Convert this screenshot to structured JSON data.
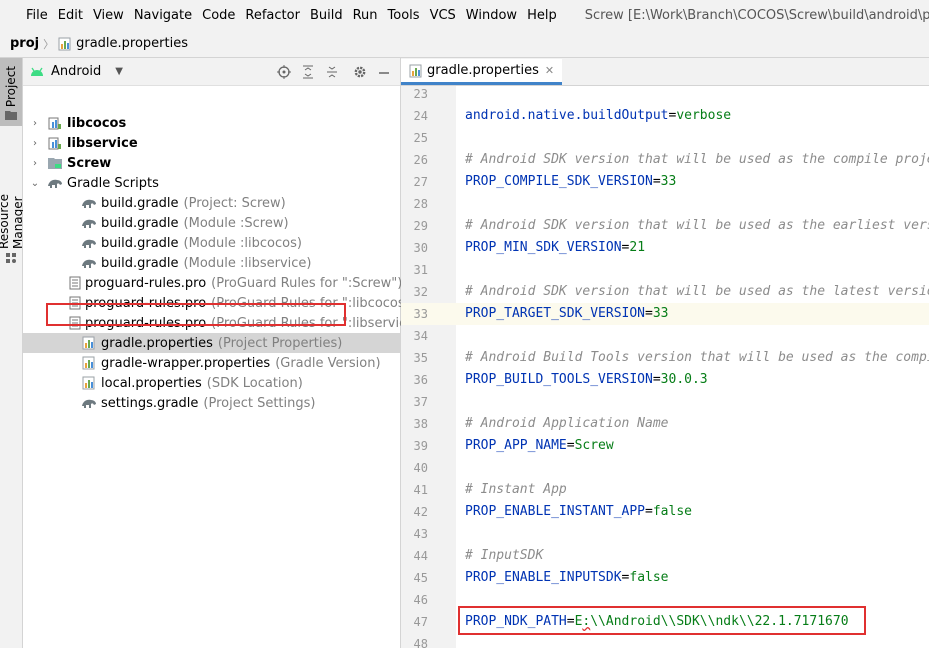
{
  "menubar": {
    "items": [
      "File",
      "Edit",
      "View",
      "Navigate",
      "Code",
      "Refactor",
      "Build",
      "Run",
      "Tools",
      "VCS",
      "Window",
      "Help"
    ],
    "window_title": "Screw [E:\\Work\\Branch\\COCOS\\Screw\\build\\android\\proj]"
  },
  "breadcrumb": {
    "root": "proj",
    "file": "gradle.properties"
  },
  "stripe": {
    "project_label": "Project",
    "resource_label": "Resource Manager"
  },
  "panel": {
    "view_label": "Android",
    "tree": [
      {
        "label": "libcocos",
        "hint": "",
        "bold": true,
        "arrow": "›",
        "icon": "module",
        "indent": 0
      },
      {
        "label": "libservice",
        "hint": "",
        "bold": true,
        "arrow": "›",
        "icon": "module",
        "indent": 0
      },
      {
        "label": "Screw",
        "hint": "",
        "bold": true,
        "arrow": "›",
        "icon": "folder",
        "indent": 0
      },
      {
        "label": "Gradle Scripts",
        "hint": "",
        "bold": false,
        "arrow": "⌄",
        "icon": "gradle",
        "indent": 0
      },
      {
        "label": "build.gradle",
        "hint": "(Project: Screw)",
        "bold": false,
        "arrow": "",
        "icon": "gradle",
        "indent": 1
      },
      {
        "label": "build.gradle",
        "hint": "(Module :Screw)",
        "bold": false,
        "arrow": "",
        "icon": "gradle",
        "indent": 1
      },
      {
        "label": "build.gradle",
        "hint": "(Module :libcocos)",
        "bold": false,
        "arrow": "",
        "icon": "gradle",
        "indent": 1
      },
      {
        "label": "build.gradle",
        "hint": "(Module :libservice)",
        "bold": false,
        "arrow": "",
        "icon": "gradle",
        "indent": 1
      },
      {
        "label": "proguard-rules.pro",
        "hint": "(ProGuard Rules for \":Screw\")",
        "bold": false,
        "arrow": "",
        "icon": "file",
        "indent": 1
      },
      {
        "label": "proguard-rules.pro",
        "hint": "(ProGuard Rules for \":libcocos\")",
        "bold": false,
        "arrow": "",
        "icon": "file",
        "indent": 1
      },
      {
        "label": "proguard-rules.pro",
        "hint": "(ProGuard Rules for \":libservice\")",
        "bold": false,
        "arrow": "",
        "icon": "file",
        "indent": 1
      },
      {
        "label": "gradle.properties",
        "hint": "(Project Properties)",
        "bold": false,
        "arrow": "",
        "icon": "props",
        "indent": 1,
        "selected": true
      },
      {
        "label": "gradle-wrapper.properties",
        "hint": "(Gradle Version)",
        "bold": false,
        "arrow": "",
        "icon": "props",
        "indent": 1
      },
      {
        "label": "local.properties",
        "hint": "(SDK Location)",
        "bold": false,
        "arrow": "",
        "icon": "props",
        "indent": 1
      },
      {
        "label": "settings.gradle",
        "hint": "(Project Settings)",
        "bold": false,
        "arrow": "",
        "icon": "gradle",
        "indent": 1
      }
    ]
  },
  "editor": {
    "tab_label": "gradle.properties",
    "current_line": 33,
    "lines": [
      {
        "n": 23,
        "type": "blank",
        "text": ""
      },
      {
        "n": 24,
        "type": "kv",
        "key": "android.native.buildOutput",
        "value": "verbose"
      },
      {
        "n": 25,
        "type": "blank",
        "text": ""
      },
      {
        "n": 26,
        "type": "comment",
        "text": "# Android SDK version that will be used as the compile project"
      },
      {
        "n": 27,
        "type": "kv",
        "key": "PROP_COMPILE_SDK_VERSION",
        "value": "33"
      },
      {
        "n": 28,
        "type": "blank",
        "text": ""
      },
      {
        "n": 29,
        "type": "comment",
        "text": "# Android SDK version that will be used as the earliest version"
      },
      {
        "n": 30,
        "type": "kv",
        "key": "PROP_MIN_SDK_VERSION",
        "value": "21"
      },
      {
        "n": 31,
        "type": "blank",
        "text": ""
      },
      {
        "n": 32,
        "type": "comment",
        "text": "# Android SDK version that will be used as the latest version"
      },
      {
        "n": 33,
        "type": "kv",
        "key": "PROP_TARGET_SDK_VERSION",
        "value": "33"
      },
      {
        "n": 34,
        "type": "blank",
        "text": ""
      },
      {
        "n": 35,
        "type": "comment",
        "text": "# Android Build Tools version that will be used as the compile"
      },
      {
        "n": 36,
        "type": "kv",
        "key": "PROP_BUILD_TOOLS_VERSION",
        "value": "30.0.3"
      },
      {
        "n": 37,
        "type": "blank",
        "text": ""
      },
      {
        "n": 38,
        "type": "comment",
        "text": "# Android Application Name"
      },
      {
        "n": 39,
        "type": "kv",
        "key": "PROP_APP_NAME",
        "value": "Screw"
      },
      {
        "n": 40,
        "type": "blank",
        "text": ""
      },
      {
        "n": 41,
        "type": "comment",
        "text": "# Instant App"
      },
      {
        "n": 42,
        "type": "kv",
        "key": "PROP_ENABLE_INSTANT_APP",
        "value": "false"
      },
      {
        "n": 43,
        "type": "blank",
        "text": ""
      },
      {
        "n": 44,
        "type": "comment",
        "text": "# InputSDK"
      },
      {
        "n": 45,
        "type": "kv",
        "key": "PROP_ENABLE_INPUTSDK",
        "value": "false"
      },
      {
        "n": 46,
        "type": "blank",
        "text": ""
      },
      {
        "n": 47,
        "type": "kv_ndk",
        "key": "PROP_NDK_PATH",
        "value_a": "E",
        "value_b": ":",
        "value_c": "\\\\Android\\\\SDK\\\\ndk\\\\22.1.7171670"
      },
      {
        "n": 48,
        "type": "blank",
        "text": ""
      }
    ]
  },
  "colors": {
    "highlight_box": "#e03030",
    "tab_underline": "#4083c9",
    "key": "#0033b3",
    "value": "#067d17",
    "comment": "#8c8c8c"
  }
}
